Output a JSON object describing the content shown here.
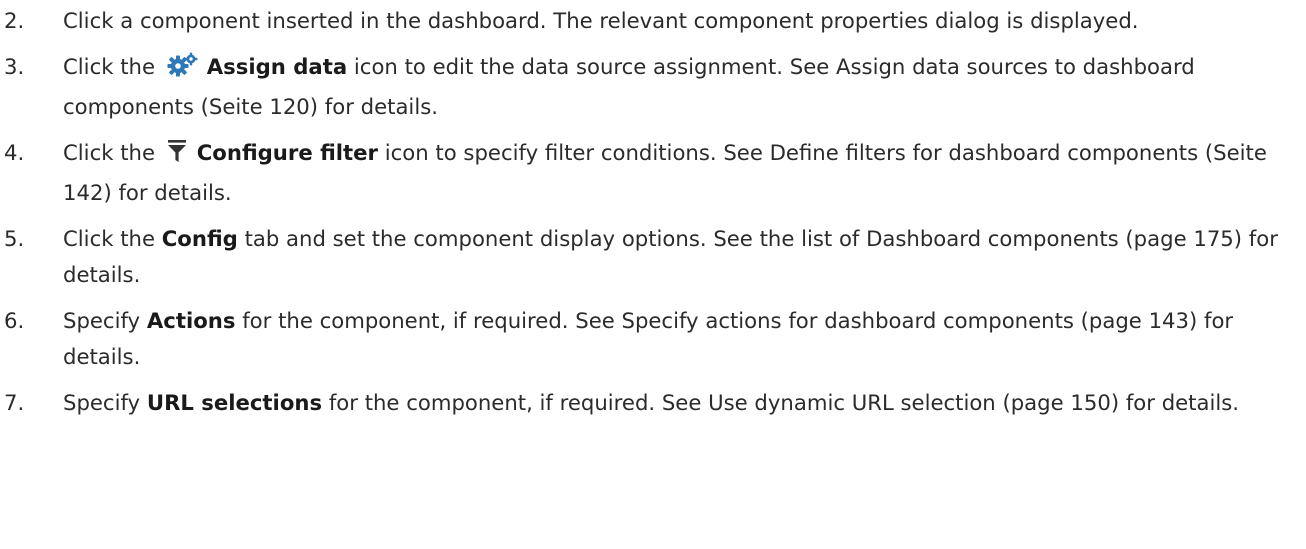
{
  "steps": [
    {
      "number": "2.",
      "text_before": "Click a component inserted in the dashboard. The relevant component properties dialog is displayed."
    },
    {
      "number": "3.",
      "text_before": "Click the",
      "icon": "assign-data-gear-icon",
      "bold": "Assign data",
      "text_after": "icon to edit the data source assignment. See Assign data sources to dashboard components (Seite 120) for details."
    },
    {
      "number": "4.",
      "text_before": "Click the",
      "icon": "configure-filter-icon",
      "bold": "Configure filter",
      "text_after": "icon to specify filter conditions. See Define filters for dashboard components (Seite 142) for details."
    },
    {
      "number": "5.",
      "text_before": "Click the",
      "bold": "Config",
      "text_after": "tab and set the component display options. See the list of Dashboard components (page 175) for details."
    },
    {
      "number": "6.",
      "text_before": "Specify",
      "bold": "Actions",
      "text_after": "for the component, if required. See Specify actions for dashboard components (page 143) for details."
    },
    {
      "number": "7.",
      "text_before": "Specify",
      "bold": "URL selections",
      "text_after": "for the component, if required. See Use dynamic URL selection (page 150) for details."
    }
  ],
  "colors": {
    "text": "#2b2b2b",
    "gear_icon": "#2e78b7",
    "filter_icon": "#333333"
  }
}
